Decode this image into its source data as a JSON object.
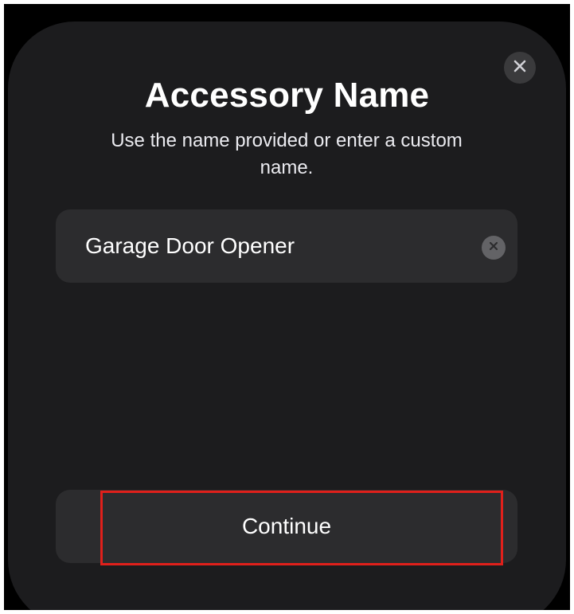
{
  "dialog": {
    "title": "Accessory Name",
    "subtitle": "Use the name provided or enter a custom name.",
    "close_icon": "xmark-icon"
  },
  "name_field": {
    "value": "Garage Door Opener",
    "clear_icon": "xmark-circle-icon"
  },
  "continue_button": {
    "label": "Continue"
  },
  "colors": {
    "background": "#000000",
    "sheet": "#1c1c1e",
    "control": "#2c2c2e",
    "text": "#ffffff",
    "highlight": "#e0201b"
  }
}
